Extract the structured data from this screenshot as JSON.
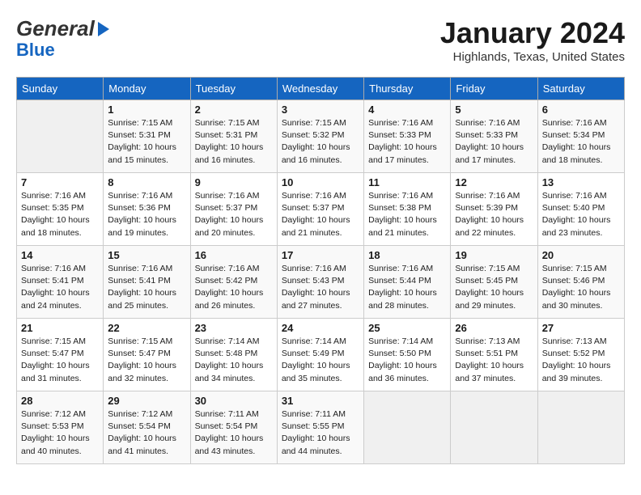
{
  "header": {
    "logo_general": "General",
    "logo_blue": "Blue",
    "month_title": "January 2024",
    "location": "Highlands, Texas, United States"
  },
  "days_of_week": [
    "Sunday",
    "Monday",
    "Tuesday",
    "Wednesday",
    "Thursday",
    "Friday",
    "Saturday"
  ],
  "weeks": [
    [
      {
        "day": "",
        "detail": ""
      },
      {
        "day": "1",
        "detail": "Sunrise: 7:15 AM\nSunset: 5:31 PM\nDaylight: 10 hours\nand 15 minutes."
      },
      {
        "day": "2",
        "detail": "Sunrise: 7:15 AM\nSunset: 5:31 PM\nDaylight: 10 hours\nand 16 minutes."
      },
      {
        "day": "3",
        "detail": "Sunrise: 7:15 AM\nSunset: 5:32 PM\nDaylight: 10 hours\nand 16 minutes."
      },
      {
        "day": "4",
        "detail": "Sunrise: 7:16 AM\nSunset: 5:33 PM\nDaylight: 10 hours\nand 17 minutes."
      },
      {
        "day": "5",
        "detail": "Sunrise: 7:16 AM\nSunset: 5:33 PM\nDaylight: 10 hours\nand 17 minutes."
      },
      {
        "day": "6",
        "detail": "Sunrise: 7:16 AM\nSunset: 5:34 PM\nDaylight: 10 hours\nand 18 minutes."
      }
    ],
    [
      {
        "day": "7",
        "detail": "Sunrise: 7:16 AM\nSunset: 5:35 PM\nDaylight: 10 hours\nand 18 minutes."
      },
      {
        "day": "8",
        "detail": "Sunrise: 7:16 AM\nSunset: 5:36 PM\nDaylight: 10 hours\nand 19 minutes."
      },
      {
        "day": "9",
        "detail": "Sunrise: 7:16 AM\nSunset: 5:37 PM\nDaylight: 10 hours\nand 20 minutes."
      },
      {
        "day": "10",
        "detail": "Sunrise: 7:16 AM\nSunset: 5:37 PM\nDaylight: 10 hours\nand 21 minutes."
      },
      {
        "day": "11",
        "detail": "Sunrise: 7:16 AM\nSunset: 5:38 PM\nDaylight: 10 hours\nand 21 minutes."
      },
      {
        "day": "12",
        "detail": "Sunrise: 7:16 AM\nSunset: 5:39 PM\nDaylight: 10 hours\nand 22 minutes."
      },
      {
        "day": "13",
        "detail": "Sunrise: 7:16 AM\nSunset: 5:40 PM\nDaylight: 10 hours\nand 23 minutes."
      }
    ],
    [
      {
        "day": "14",
        "detail": "Sunrise: 7:16 AM\nSunset: 5:41 PM\nDaylight: 10 hours\nand 24 minutes."
      },
      {
        "day": "15",
        "detail": "Sunrise: 7:16 AM\nSunset: 5:41 PM\nDaylight: 10 hours\nand 25 minutes."
      },
      {
        "day": "16",
        "detail": "Sunrise: 7:16 AM\nSunset: 5:42 PM\nDaylight: 10 hours\nand 26 minutes."
      },
      {
        "day": "17",
        "detail": "Sunrise: 7:16 AM\nSunset: 5:43 PM\nDaylight: 10 hours\nand 27 minutes."
      },
      {
        "day": "18",
        "detail": "Sunrise: 7:16 AM\nSunset: 5:44 PM\nDaylight: 10 hours\nand 28 minutes."
      },
      {
        "day": "19",
        "detail": "Sunrise: 7:15 AM\nSunset: 5:45 PM\nDaylight: 10 hours\nand 29 minutes."
      },
      {
        "day": "20",
        "detail": "Sunrise: 7:15 AM\nSunset: 5:46 PM\nDaylight: 10 hours\nand 30 minutes."
      }
    ],
    [
      {
        "day": "21",
        "detail": "Sunrise: 7:15 AM\nSunset: 5:47 PM\nDaylight: 10 hours\nand 31 minutes."
      },
      {
        "day": "22",
        "detail": "Sunrise: 7:15 AM\nSunset: 5:47 PM\nDaylight: 10 hours\nand 32 minutes."
      },
      {
        "day": "23",
        "detail": "Sunrise: 7:14 AM\nSunset: 5:48 PM\nDaylight: 10 hours\nand 34 minutes."
      },
      {
        "day": "24",
        "detail": "Sunrise: 7:14 AM\nSunset: 5:49 PM\nDaylight: 10 hours\nand 35 minutes."
      },
      {
        "day": "25",
        "detail": "Sunrise: 7:14 AM\nSunset: 5:50 PM\nDaylight: 10 hours\nand 36 minutes."
      },
      {
        "day": "26",
        "detail": "Sunrise: 7:13 AM\nSunset: 5:51 PM\nDaylight: 10 hours\nand 37 minutes."
      },
      {
        "day": "27",
        "detail": "Sunrise: 7:13 AM\nSunset: 5:52 PM\nDaylight: 10 hours\nand 39 minutes."
      }
    ],
    [
      {
        "day": "28",
        "detail": "Sunrise: 7:12 AM\nSunset: 5:53 PM\nDaylight: 10 hours\nand 40 minutes."
      },
      {
        "day": "29",
        "detail": "Sunrise: 7:12 AM\nSunset: 5:54 PM\nDaylight: 10 hours\nand 41 minutes."
      },
      {
        "day": "30",
        "detail": "Sunrise: 7:11 AM\nSunset: 5:54 PM\nDaylight: 10 hours\nand 43 minutes."
      },
      {
        "day": "31",
        "detail": "Sunrise: 7:11 AM\nSunset: 5:55 PM\nDaylight: 10 hours\nand 44 minutes."
      },
      {
        "day": "",
        "detail": ""
      },
      {
        "day": "",
        "detail": ""
      },
      {
        "day": "",
        "detail": ""
      }
    ]
  ]
}
